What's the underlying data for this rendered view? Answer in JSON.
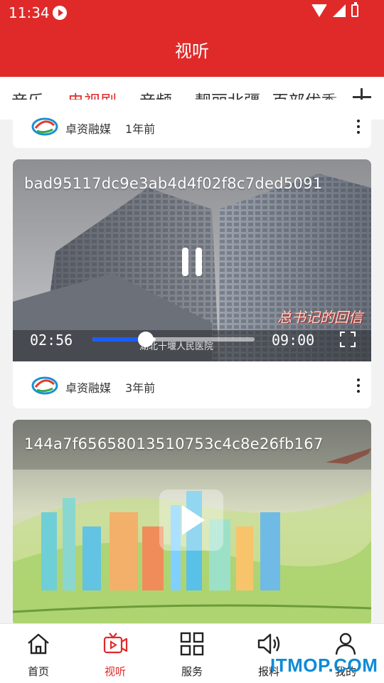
{
  "status_bar": {
    "time": "11:34"
  },
  "header": {
    "title": "视听"
  },
  "tabs": [
    {
      "label": "音乐",
      "active": false
    },
    {
      "label": "电视剧",
      "active": true
    },
    {
      "label": "音频",
      "active": false
    },
    {
      "label": "靓丽北疆--百部优秀",
      "active": false
    }
  ],
  "feed": {
    "card0": {
      "author": "卓资融媒",
      "ago": "1年前"
    },
    "card1": {
      "video_title": "bad95117dc9e3ab4d4f02f8c7ded5091",
      "state": "playing",
      "current_time": "02:56",
      "duration": "09:00",
      "progress": 0.327,
      "buffered": 0.39,
      "overlay_caption": "湖北十堰人民医院",
      "corner_logo": "总书记的回信",
      "author": "卓资融媒",
      "ago": "3年前"
    },
    "card2": {
      "video_title": "144a7f65658013510753c4c8e26fb167",
      "state": "paused"
    }
  },
  "bottom_nav": [
    {
      "label": "首页",
      "icon": "home-icon",
      "active": false
    },
    {
      "label": "视听",
      "icon": "tv-play-icon",
      "active": true
    },
    {
      "label": "服务",
      "icon": "grid-icon",
      "active": false
    },
    {
      "label": "报料",
      "icon": "speaker-icon",
      "active": false
    },
    {
      "label": "我的",
      "icon": "user-icon",
      "active": false
    }
  ],
  "watermark": "ITMOP.COM",
  "colors": {
    "brand_red": "#e02a2a",
    "seek_blue": "#1a5cff",
    "text_dark": "#333333"
  }
}
